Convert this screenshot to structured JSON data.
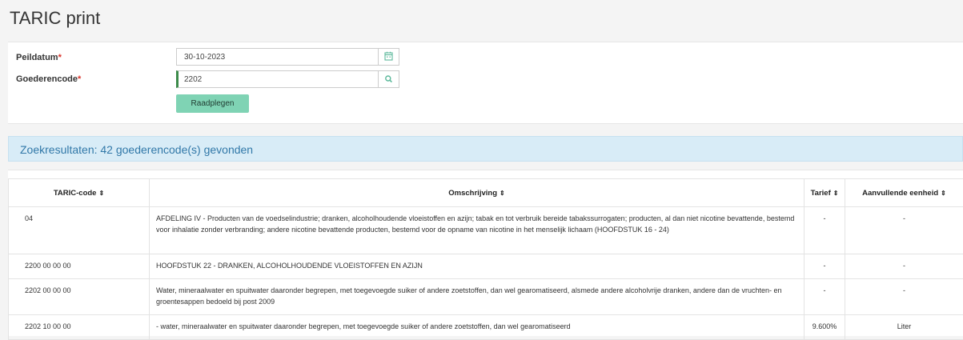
{
  "page": {
    "title": "TARIC print"
  },
  "form": {
    "peildatum": {
      "label": "Peildatum",
      "required_mark": "*",
      "value": "30-10-2023",
      "icon": "calendar-icon"
    },
    "goederencode": {
      "label": "Goederencode",
      "required_mark": "*",
      "value": "2202",
      "icon": "search-icon"
    },
    "submit_label": "Raadplegen"
  },
  "results": {
    "summary": "Zoekresultaten: 42 goederencode(s) gevonden"
  },
  "table": {
    "headers": {
      "code": "TARIC-code",
      "description": "Omschrijving",
      "tarief": "Tarief",
      "unit": "Aanvullende eenheid",
      "sort_glyph": "⇕"
    },
    "rows": [
      {
        "code": "04",
        "description": "AFDELING IV - Producten van de voedselindustrie; dranken, alcoholhoudende vloeistoffen en azijn; tabak en tot verbruik bereide tabakssurrogaten; producten, al dan niet nicotine bevattende, bestemd voor inhalatie zonder verbranding; andere nicotine bevattende producten, bestemd voor de opname van nicotine in het menselijk lichaam (HOOFDSTUK 16 - 24)",
        "tarief": "-",
        "unit": "-"
      },
      {
        "code": "2200 00 00 00",
        "description": "HOOFDSTUK 22 - DRANKEN, ALCOHOLHOUDENDE VLOEISTOFFEN EN AZIJN",
        "tarief": "-",
        "unit": "-"
      },
      {
        "code": "2202 00 00 00",
        "description": " Water, mineraalwater en spuitwater daaronder begrepen, met toegevoegde suiker of andere zoetstoffen, dan wel gearomatiseerd, alsmede andere alcoholvrije dranken, andere dan de vruchten- en groentesappen bedoeld bij post 2009",
        "tarief": "-",
        "unit": "-"
      },
      {
        "code": "2202 10 00 00",
        "description": "- water, mineraalwater en spuitwater daaronder begrepen, met toegevoegde suiker of andere zoetstoffen, dan wel gearomatiseerd",
        "tarief": "9.600%",
        "unit": "Liter"
      }
    ]
  },
  "colors": {
    "accent_button": "#7fd3b4",
    "info_bar": "#d8ecf7",
    "info_text": "#3178a8",
    "active_border": "#3c8b4a",
    "required": "#d9342b"
  }
}
